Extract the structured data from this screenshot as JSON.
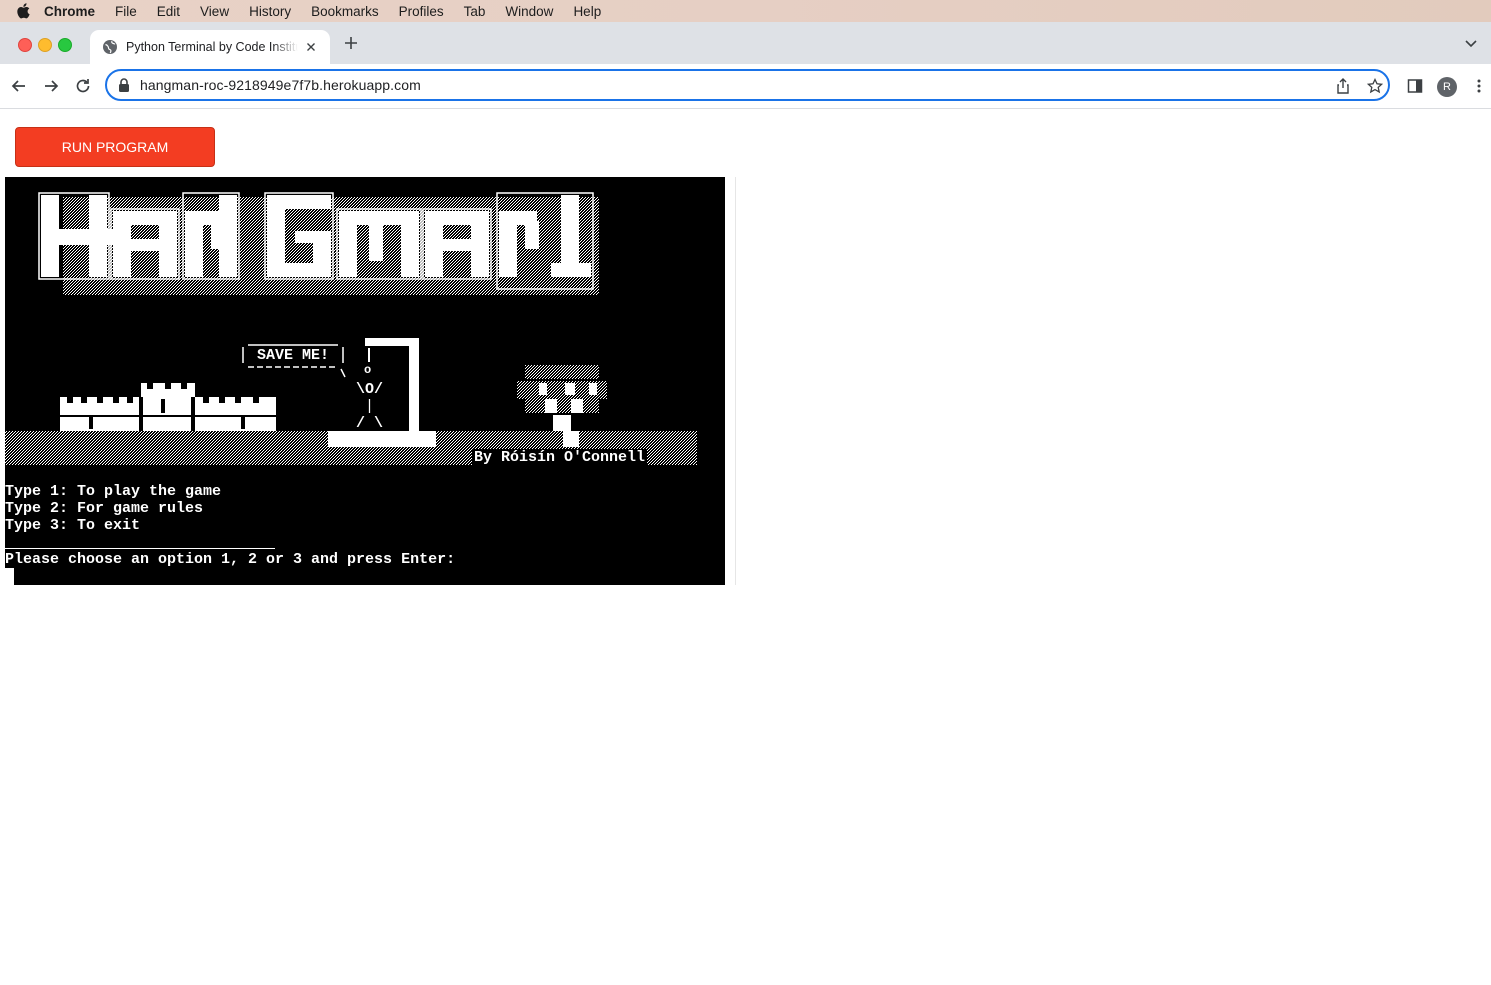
{
  "menubar": {
    "app": "Chrome",
    "items": [
      "File",
      "Edit",
      "View",
      "History",
      "Bookmarks",
      "Profiles",
      "Tab",
      "Window",
      "Help"
    ]
  },
  "tab": {
    "title": "Python Terminal by Code Institute"
  },
  "toolbar": {
    "url": "hangman-roc-9218949e7f7b.herokuapp.com",
    "profile_initial": "R"
  },
  "page": {
    "run_button": "RUN PROGRAM"
  },
  "terminal": {
    "save_me": "SAVE ME!",
    "figure_head": "o",
    "figure_arms": "\\O/",
    "figure_body": "|",
    "figure_legs": "/ \\",
    "byline": "By Róisín O'Connell",
    "menu_lines": [
      "Type 1: To play the game",
      "Type 2: For game rules",
      "Type 3: To exit"
    ],
    "prompt": "Please choose an option 1, 2 or 3 and press Enter:"
  },
  "colors": {
    "run_button_bg": "#f33d22",
    "terminal_bg": "#000000",
    "terminal_fg": "#ffffff",
    "omnibox_focus": "#1a73e8"
  }
}
